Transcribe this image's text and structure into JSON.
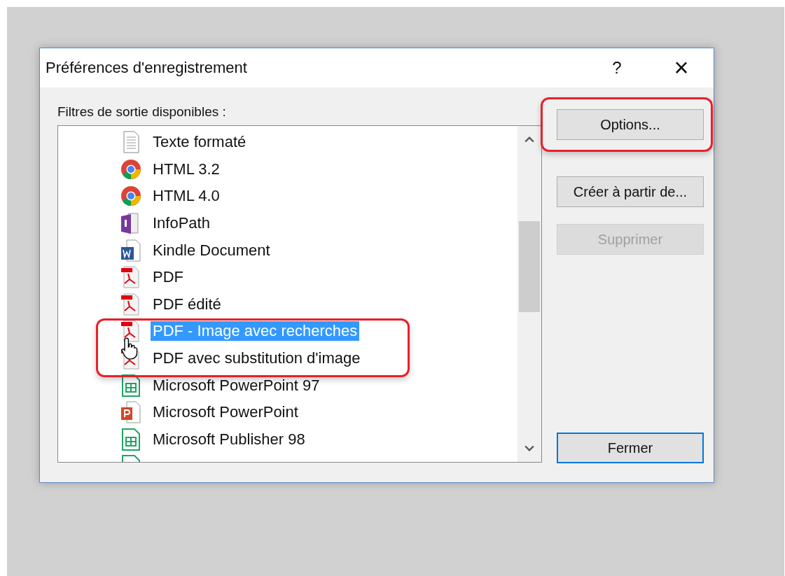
{
  "window": {
    "title": "Préférences d'enregistrement",
    "help": "?",
    "close": "×"
  },
  "filters_label": "Filtres de sortie disponibles :",
  "filters": [
    {
      "label": "Texte formaté",
      "kind": "text",
      "selected": false
    },
    {
      "label": "HTML 3.2",
      "kind": "browser",
      "selected": false
    },
    {
      "label": "HTML 4.0",
      "kind": "browser",
      "selected": false
    },
    {
      "label": "InfoPath",
      "kind": "infopath",
      "selected": false
    },
    {
      "label": "Kindle Document",
      "kind": "word",
      "selected": false
    },
    {
      "label": "PDF",
      "kind": "pdf",
      "selected": false
    },
    {
      "label": "PDF édité",
      "kind": "pdf",
      "selected": false
    },
    {
      "label": "PDF - Image avec recherches",
      "kind": "pdf",
      "selected": true
    },
    {
      "label": "PDF avec substitution d'image",
      "kind": "pdf",
      "selected": false
    },
    {
      "label": "Microsoft PowerPoint 97",
      "kind": "sheet",
      "selected": false
    },
    {
      "label": "Microsoft PowerPoint",
      "kind": "powerpoint",
      "selected": false
    },
    {
      "label": "Microsoft Publisher 98",
      "kind": "sheet",
      "selected": false
    },
    {
      "kind": "sheet"
    }
  ],
  "buttons": [
    {
      "label": "Options...",
      "disabled": false,
      "default": false,
      "highlighted": true
    },
    {
      "label": "Créer à partir de...",
      "disabled": false,
      "default": false,
      "highlighted": false
    },
    {
      "label": "Supprimer",
      "disabled": true,
      "default": false,
      "highlighted": false
    },
    {
      "label": "Fermer",
      "disabled": false,
      "default": true,
      "highlighted": false
    }
  ]
}
